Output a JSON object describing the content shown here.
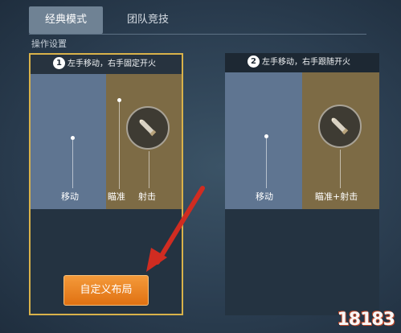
{
  "tabs": [
    {
      "label": "经典模式",
      "active": true
    },
    {
      "label": "团队竞技",
      "active": false
    }
  ],
  "section_label": "操作设置",
  "cards": [
    {
      "number": "1",
      "title": "左手移动，右手固定开火",
      "selected": true,
      "labels": {
        "move": "移动",
        "aim": "瞄准",
        "fire": "射击"
      },
      "button_label": "自定义布局"
    },
    {
      "number": "2",
      "title": "左手移动，右手跟随开火",
      "selected": false,
      "labels": {
        "move": "移动",
        "aim_fire": "瞄准+射击"
      }
    }
  ],
  "watermark": "18183",
  "colors": {
    "accent_border": "#d9b24a",
    "button": "#e8801f",
    "arrow": "#d02c21"
  }
}
